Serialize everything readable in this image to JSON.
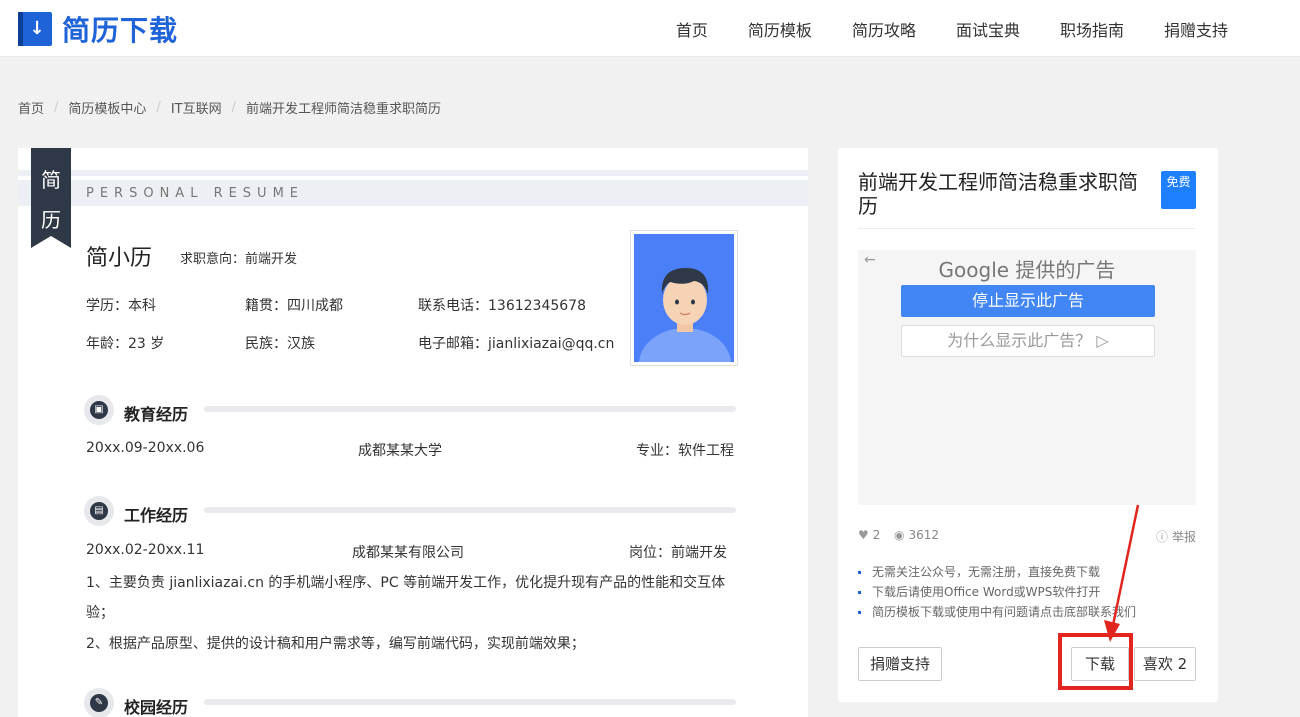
{
  "header": {
    "logo_text": "简历下载",
    "nav": [
      "首页",
      "简历模板",
      "简历攻略",
      "面试宝典",
      "职场指南",
      "捐赠支持"
    ]
  },
  "breadcrumb": [
    "首页",
    "简历模板中心",
    "IT互联网",
    "前端开发工程师简洁稳重求职简历"
  ],
  "resume": {
    "ribbon": [
      "简",
      "历"
    ],
    "title_en": "PERSONAL RESUME",
    "name": "简小历",
    "intent": "求职意向：前端开发",
    "info": {
      "edu": "学历：本科",
      "native": "籍贯：四川成都",
      "phone": "联系电话：13612345678",
      "age": "年龄：23 岁",
      "ethnic": "民族：汉族",
      "email": "电子邮箱：jianlixiazai@qq.cn"
    },
    "education": {
      "title": "教育经历",
      "period": "20xx.09-20xx.06",
      "school": "成都某某大学",
      "major": "专业：软件工程"
    },
    "work": {
      "title": "工作经历",
      "period": "20xx.02-20xx.11",
      "company": "成都某某有限公司",
      "position": "岗位：前端开发",
      "line1": "1、主要负责 jianlixiazai.cn 的手机端小程序、PC 等前端开发工作，优化提升现有产品的性能和交互体",
      "line1b": "验；",
      "line2": "2、根据产品原型、提供的设计稿和用户需求等，编写前端代码，实现前端效果；"
    },
    "campus": {
      "title": "校园经历"
    }
  },
  "card": {
    "title": "前端开发工程师简洁稳重求职简历",
    "badge": "免费",
    "ad": {
      "back": "←",
      "google": "Google 提供的广告",
      "stop": "停止显示此广告",
      "why": "为什么显示此广告？ ▷"
    },
    "likes": "2",
    "views": "3612",
    "report": "举报",
    "notes": [
      "无需关注公众号，无需注册，直接免费下载",
      "下载后请使用Office Word或WPS软件打开",
      "简历模板下载或使用中有问题请点击底部联系我们"
    ],
    "donate_btn": "捐赠支持",
    "download_btn": "下载",
    "like_btn": "喜欢 2"
  },
  "colors": {
    "brand": "#1f63d8",
    "highlight": "#e2261f",
    "dark": "#2f3846"
  }
}
